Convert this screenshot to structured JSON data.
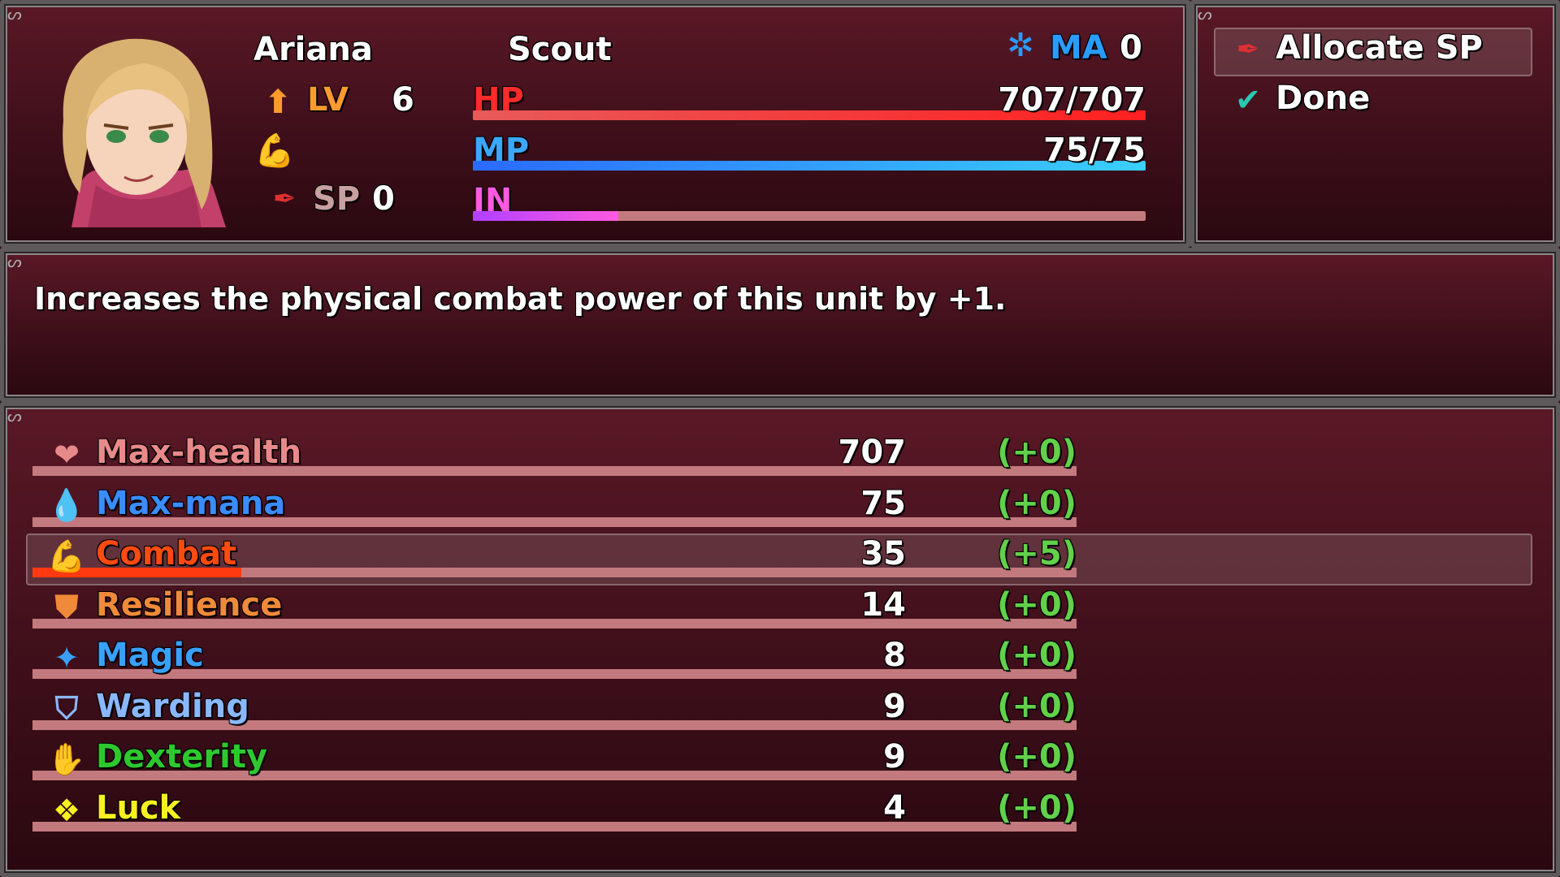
{
  "status": {
    "name": "Ariana",
    "class": "Scout",
    "lv_label": "LV",
    "lv_value": "6",
    "sp_label": "SP",
    "sp_value": "0",
    "ma_label": "MA",
    "ma_value": "0",
    "hp_label": "HP",
    "hp_value": "707/707",
    "hp_fraction": 1.0,
    "mp_label": "MP",
    "mp_value": "75/75",
    "mp_fraction": 1.0,
    "in_label": "IN",
    "in_fraction": 0.216
  },
  "commands": [
    {
      "label": "Allocate SP",
      "icon": "feather-icon",
      "selected": true
    },
    {
      "label": "Done",
      "icon": "checkmark-icon",
      "selected": false
    }
  ],
  "help": {
    "text": "Increases the physical combat power of this unit by +1."
  },
  "stats": [
    {
      "name": "Max-health",
      "value": "707",
      "bonus": "(+0)",
      "color": "#e88a8a",
      "icon": "heart-icon",
      "fill": 0
    },
    {
      "name": "Max-mana",
      "value": "75",
      "bonus": "(+0)",
      "color": "#3a8cff",
      "icon": "mana-drop-icon",
      "fill": 0
    },
    {
      "name": "Combat",
      "value": "35",
      "bonus": "(+5)",
      "color": "#ff4a10",
      "icon": "flexed-arm-icon",
      "fill": 0.2
    },
    {
      "name": "Resilience",
      "value": "14",
      "bonus": "(+0)",
      "color": "#f08a3a",
      "icon": "armor-icon",
      "fill": 0
    },
    {
      "name": "Magic",
      "value": "8",
      "bonus": "(+0)",
      "color": "#3aa0ff",
      "icon": "wand-icon",
      "fill": 0
    },
    {
      "name": "Warding",
      "value": "9",
      "bonus": "(+0)",
      "color": "#8ab8ff",
      "icon": "shield-icon",
      "fill": 0
    },
    {
      "name": "Dexterity",
      "value": "9",
      "bonus": "(+0)",
      "color": "#2ec82e",
      "icon": "hand-icon",
      "fill": 0
    },
    {
      "name": "Luck",
      "value": "4",
      "bonus": "(+0)",
      "color": "#f8f020",
      "icon": "clover-icon",
      "fill": 0
    }
  ],
  "colors": {
    "hp": "#ff2a2a",
    "mp": "#3aa8ff",
    "in": "#ff5ae0",
    "lv": "#ff9a30",
    "sp": "#c8a0a0",
    "ma": "#2a9cff",
    "bonus": "#62d04a"
  }
}
